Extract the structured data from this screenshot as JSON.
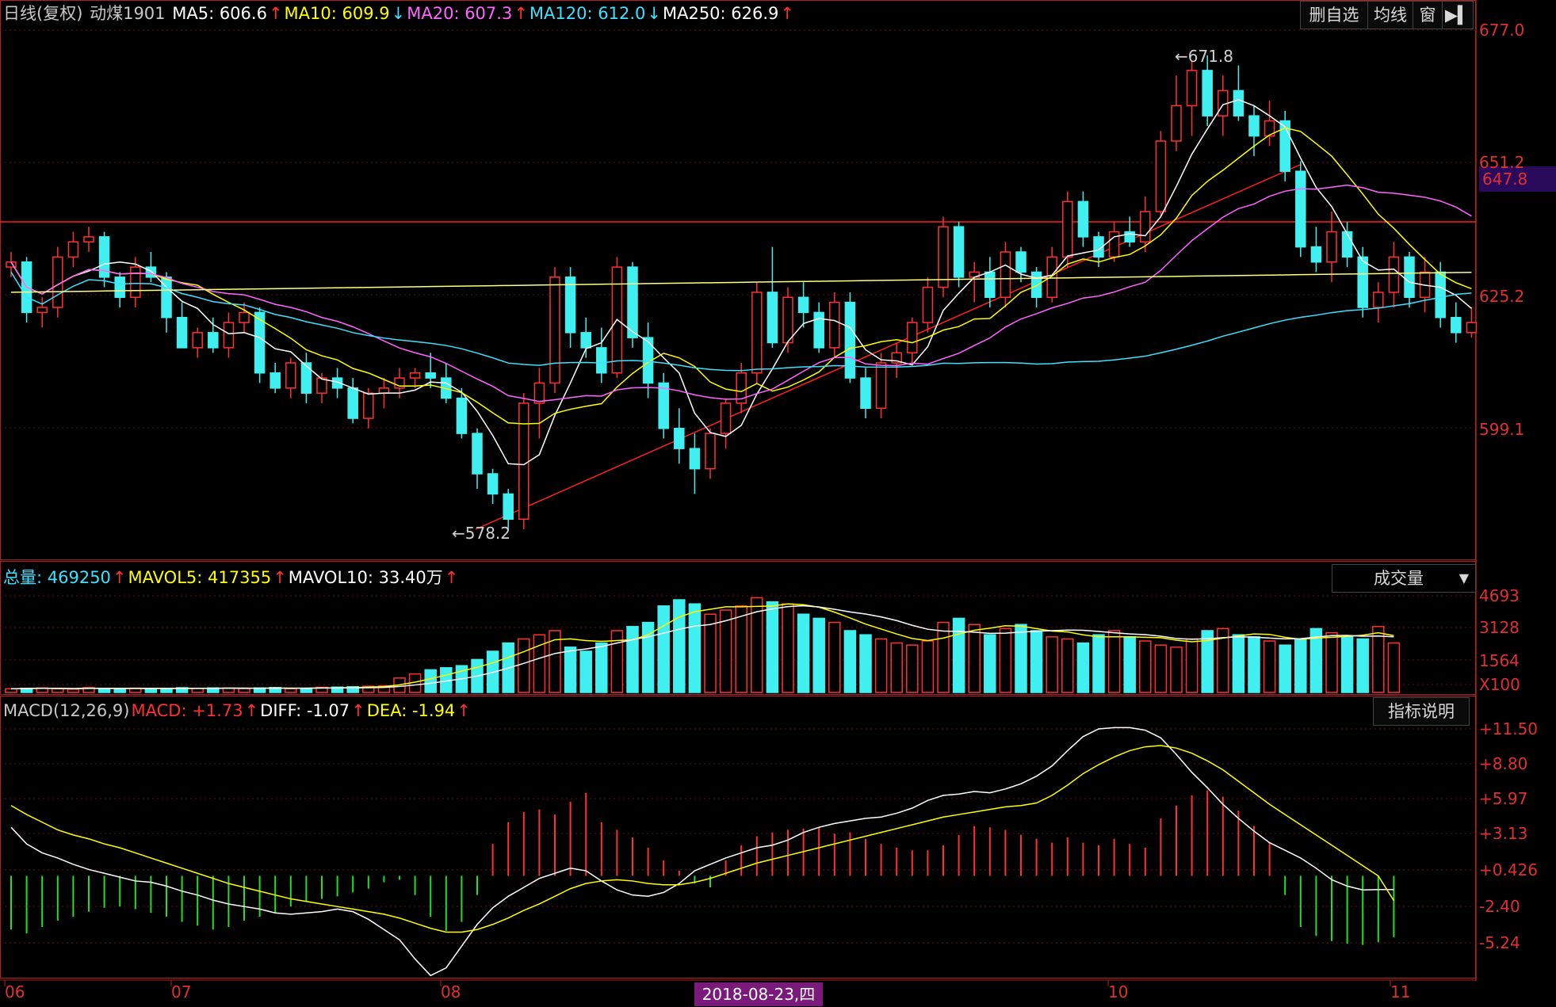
{
  "header": {
    "period": "日线(复权)",
    "symbol": "动煤1901",
    "ma": [
      {
        "label": "MA5: 606.6",
        "arrow": "↑",
        "color": "#ffffff",
        "arrow_color": "#ff3030"
      },
      {
        "label": "MA10: 609.9",
        "arrow": "↓",
        "color": "#ffff00",
        "arrow_color": "#40e0ff"
      },
      {
        "label": "MA20: 607.3",
        "arrow": "↑",
        "color": "#ff66ff",
        "arrow_color": "#ff3030"
      },
      {
        "label": "MA120: 612.0",
        "arrow": "↓",
        "color": "#40e0ff",
        "arrow_color": "#40e0ff"
      },
      {
        "label": "MA250: 626.9",
        "arrow": "↑",
        "color": "#ffffff",
        "arrow_color": "#ff3030"
      }
    ],
    "buttons": [
      "删自选",
      "均线",
      "窗",
      "▶▍"
    ]
  },
  "volume_header": {
    "items": [
      {
        "label": "总量: 469250",
        "arrow": "↑",
        "color": "#40e0ff"
      },
      {
        "label": "MAVOL5: 417355",
        "arrow": "↑",
        "color": "#ffff00"
      },
      {
        "label": "MAVOL10: 33.40万",
        "arrow": "↑",
        "color": "#ffffff"
      }
    ],
    "dropdown": "成交量",
    "dropdown_arrow": "▼"
  },
  "macd_header": {
    "items": [
      {
        "label": "MACD(12,26,9)",
        "arrow": "",
        "color": "#c8c8c8"
      },
      {
        "label": "MACD: +1.73",
        "arrow": "↑",
        "color": "#ff3030"
      },
      {
        "label": "DIFF: -1.07",
        "arrow": "↑",
        "color": "#ffffff"
      },
      {
        "label": "DEA: -1.94",
        "arrow": "↑",
        "color": "#ffff00"
      }
    ],
    "button": "指标说明"
  },
  "price_axis": [
    "677.0",
    "651.2",
    "625.2",
    "599.1"
  ],
  "price_tag": "647.8",
  "volume_axis": [
    "4693",
    "3128",
    "1564",
    "X100"
  ],
  "macd_axis": [
    "+11.50",
    "+8.80",
    "+5.97",
    "+3.13",
    "+0.426",
    "-2.40",
    "-5.24"
  ],
  "x_labels": [
    "06",
    "07",
    "08",
    "10",
    "11"
  ],
  "date_flag": "2018-08-23,四",
  "annotations": {
    "high": "671.8",
    "low": "578.2"
  },
  "chart_data": {
    "type": "candlestick",
    "y_range_price": [
      560,
      680
    ],
    "volume_range_x100": [
      0,
      4693
    ],
    "macd_range": [
      -8.2,
      12.6
    ],
    "series_colors": {
      "up": "#ff3030",
      "down": "#40f0f0",
      "ma5": "#ffffff",
      "ma10": "#ffff00",
      "ma20": "#ff66ff",
      "ma120": "#40e0ff",
      "ma250": "#ffff80"
    },
    "candles": [
      [
        630,
        633,
        628,
        631
      ],
      [
        631,
        632,
        619,
        621
      ],
      [
        621,
        624,
        618,
        622
      ],
      [
        622,
        634,
        620,
        632
      ],
      [
        632,
        637,
        630,
        635
      ],
      [
        635,
        638,
        633,
        636
      ],
      [
        636,
        637,
        626,
        628
      ],
      [
        628,
        629,
        622,
        624
      ],
      [
        624,
        632,
        622,
        630
      ],
      [
        630,
        633,
        627,
        628
      ],
      [
        628,
        629,
        617,
        620
      ],
      [
        620,
        623,
        615,
        614
      ],
      [
        614,
        618,
        612,
        617
      ],
      [
        617,
        620,
        613,
        614
      ],
      [
        614,
        621,
        612,
        619
      ],
      [
        619,
        623,
        617,
        621
      ],
      [
        621,
        622,
        607,
        609
      ],
      [
        609,
        611,
        605,
        606
      ],
      [
        606,
        612,
        604,
        611
      ],
      [
        611,
        613,
        603,
        605
      ],
      [
        605,
        609,
        603,
        608
      ],
      [
        608,
        610,
        604,
        606
      ],
      [
        606,
        608,
        599,
        600
      ],
      [
        600,
        606,
        598,
        605
      ],
      [
        605,
        608,
        602,
        606
      ],
      [
        606,
        610,
        604,
        608
      ],
      [
        608,
        610,
        606,
        609
      ],
      [
        609,
        613,
        606,
        608
      ],
      [
        608,
        611,
        603,
        604
      ],
      [
        604,
        606,
        596,
        597
      ],
      [
        597,
        598,
        586,
        589
      ],
      [
        589,
        590,
        583,
        585
      ],
      [
        585,
        586,
        578,
        580
      ],
      [
        580,
        605,
        578,
        603
      ],
      [
        603,
        610,
        596,
        607
      ],
      [
        607,
        630,
        605,
        628
      ],
      [
        628,
        630,
        614,
        617
      ],
      [
        617,
        620,
        612,
        614
      ],
      [
        614,
        618,
        607,
        609
      ],
      [
        609,
        632,
        608,
        630
      ],
      [
        630,
        631,
        614,
        616
      ],
      [
        616,
        619,
        604,
        607
      ],
      [
        607,
        609,
        596,
        598
      ],
      [
        598,
        602,
        591,
        594
      ],
      [
        594,
        597,
        585,
        590
      ],
      [
        590,
        598,
        588,
        597
      ],
      [
        597,
        604,
        594,
        603
      ],
      [
        603,
        611,
        601,
        609
      ],
      [
        609,
        627,
        607,
        625
      ],
      [
        625,
        634,
        614,
        615
      ],
      [
        615,
        626,
        613,
        624
      ],
      [
        624,
        627,
        618,
        621
      ],
      [
        621,
        623,
        613,
        614
      ],
      [
        614,
        625,
        612,
        623
      ],
      [
        623,
        625,
        607,
        608
      ],
      [
        608,
        610,
        600,
        602
      ],
      [
        602,
        613,
        600,
        611
      ],
      [
        611,
        615,
        608,
        613
      ],
      [
        613,
        620,
        611,
        619
      ],
      [
        619,
        628,
        617,
        626
      ],
      [
        626,
        640,
        624,
        638
      ],
      [
        638,
        639,
        626,
        628
      ],
      [
        628,
        631,
        623,
        629
      ],
      [
        629,
        632,
        622,
        624
      ],
      [
        624,
        635,
        622,
        633
      ],
      [
        633,
        634,
        627,
        629
      ],
      [
        629,
        630,
        622,
        624
      ],
      [
        624,
        634,
        623,
        632
      ],
      [
        632,
        645,
        630,
        643
      ],
      [
        643,
        645,
        634,
        636
      ],
      [
        636,
        637,
        630,
        632
      ],
      [
        632,
        639,
        631,
        637
      ],
      [
        637,
        640,
        634,
        635
      ],
      [
        635,
        644,
        633,
        641
      ],
      [
        641,
        657,
        640,
        655
      ],
      [
        655,
        668,
        653,
        662
      ],
      [
        662,
        671,
        656,
        669
      ],
      [
        669,
        672,
        658,
        660
      ],
      [
        660,
        668,
        656,
        665
      ],
      [
        665,
        670,
        659,
        660
      ],
      [
        660,
        662,
        652,
        656
      ],
      [
        656,
        663,
        654,
        659
      ],
      [
        659,
        661,
        647,
        649
      ],
      [
        649,
        651,
        632,
        634
      ],
      [
        634,
        638,
        629,
        631
      ],
      [
        631,
        641,
        627,
        637
      ],
      [
        637,
        639,
        630,
        632
      ],
      [
        632,
        634,
        620,
        622
      ],
      [
        622,
        627,
        619,
        625
      ],
      [
        625,
        635,
        622,
        632
      ],
      [
        632,
        633,
        622,
        624
      ],
      [
        624,
        632,
        621,
        629
      ],
      [
        629,
        631,
        618,
        620
      ],
      [
        620,
        623,
        615,
        617
      ],
      [
        617,
        622,
        616,
        619
      ]
    ],
    "volume_x100": [
      180,
      200,
      220,
      180,
      160,
      240,
      200,
      180,
      210,
      170,
      190,
      230,
      200,
      220,
      210,
      190,
      220,
      240,
      180,
      200,
      250,
      260,
      280,
      300,
      320,
      700,
      900,
      1100,
      1200,
      1300,
      1600,
      2000,
      2400,
      2600,
      2800,
      3000,
      2200,
      2000,
      2400,
      3000,
      3200,
      3400,
      4200,
      4500,
      4300,
      3800,
      4000,
      4200,
      4600,
      4400,
      4300,
      3800,
      3600,
      3400,
      3000,
      2800,
      2600,
      2400,
      2300,
      2500,
      3400,
      3600,
      3300,
      2800,
      3100,
      3300,
      3000,
      2700,
      2600,
      2400,
      2800,
      3000,
      2700,
      2500,
      2300,
      2200,
      2600,
      3000,
      3100,
      2800,
      2700,
      2500,
      2300,
      2600,
      3100,
      2900,
      2700,
      2600,
      3200,
      2400
    ],
    "volume_colors": "alternating up/down per candle",
    "macd_hist": [
      -4.2,
      -4.5,
      -4.0,
      -3.5,
      -3.2,
      -2.8,
      -2.5,
      -2.4,
      -2.6,
      -2.9,
      -3.2,
      -3.6,
      -3.9,
      -4.2,
      -4.0,
      -3.5,
      -3.2,
      -2.9,
      -2.4,
      -2.0,
      -1.8,
      -1.6,
      -1.3,
      -1.0,
      -0.5,
      -0.3,
      -1.5,
      -3.2,
      -4.3,
      -3.6,
      -1.5,
      2.5,
      4.2,
      5.0,
      5.2,
      4.8,
      5.8,
      6.5,
      4.2,
      3.6,
      3.0,
      2.2,
      1.2,
      0.4,
      -0.6,
      -0.9,
      1.2,
      2.4,
      3.1,
      3.4,
      3.6,
      3.7,
      3.8,
      3.3,
      3.4,
      2.9,
      2.5,
      2.2,
      2.0,
      2.0,
      2.4,
      3.2,
      3.9,
      3.8,
      3.6,
      3.2,
      2.9,
      2.6,
      3.0,
      2.6,
      2.4,
      2.9,
      2.5,
      2.2,
      4.5,
      5.5,
      6.3,
      6.7,
      6.2,
      5.1,
      3.9,
      2.6,
      -1.5,
      -4.0,
      -4.7,
      -5.1,
      -5.3,
      -5.4,
      -5.2,
      -4.8
    ],
    "diff": [
      3.8,
      2.5,
      1.8,
      1.4,
      0.9,
      0.5,
      0.2,
      -0.1,
      -0.4,
      -0.5,
      -0.8,
      -1.2,
      -1.5,
      -1.9,
      -2.2,
      -2.4,
      -2.6,
      -2.9,
      -3.0,
      -2.9,
      -2.8,
      -2.6,
      -2.8,
      -3.4,
      -4.2,
      -5.0,
      -6.5,
      -7.8,
      -7.2,
      -5.5,
      -3.8,
      -2.5,
      -1.6,
      -0.9,
      -0.2,
      0.2,
      0.6,
      0.4,
      -0.4,
      -1.1,
      -1.5,
      -1.6,
      -1.3,
      -0.6,
      0.4,
      0.9,
      1.4,
      1.8,
      2.2,
      2.4,
      2.8,
      3.4,
      3.8,
      4.1,
      4.3,
      4.5,
      4.6,
      4.9,
      5.3,
      5.9,
      6.3,
      6.4,
      6.6,
      6.5,
      6.8,
      7.2,
      7.8,
      8.6,
      9.8,
      10.9,
      11.5,
      11.6,
      11.6,
      11.4,
      10.8,
      9.5,
      8.1,
      6.9,
      5.6,
      4.5,
      3.5,
      2.6,
      2.0,
      1.4,
      0.6,
      -0.3,
      -0.8,
      -1.1,
      -1.07,
      -1.07
    ],
    "dea": [
      5.5,
      4.8,
      4.2,
      3.6,
      3.2,
      2.9,
      2.5,
      2.2,
      1.8,
      1.4,
      1.0,
      0.6,
      0.2,
      -0.2,
      -0.6,
      -0.9,
      -1.2,
      -1.5,
      -1.8,
      -2.0,
      -2.2,
      -2.4,
      -2.6,
      -2.8,
      -3.0,
      -3.3,
      -3.7,
      -4.1,
      -4.4,
      -4.4,
      -4.2,
      -3.8,
      -3.3,
      -2.7,
      -2.2,
      -1.6,
      -1.0,
      -0.6,
      -0.4,
      -0.3,
      -0.4,
      -0.6,
      -0.7,
      -0.7,
      -0.5,
      -0.2,
      0.2,
      0.6,
      1.0,
      1.3,
      1.6,
      1.9,
      2.2,
      2.5,
      2.8,
      3.1,
      3.4,
      3.7,
      4.0,
      4.3,
      4.6,
      4.8,
      5.0,
      5.2,
      5.4,
      5.5,
      5.7,
      6.3,
      7.1,
      8.0,
      8.7,
      9.3,
      9.8,
      10.1,
      10.2,
      10.0,
      9.6,
      9.0,
      8.3,
      7.4,
      6.5,
      5.6,
      4.8,
      4.0,
      3.2,
      2.4,
      1.6,
      0.8,
      0.0,
      -1.94
    ]
  }
}
